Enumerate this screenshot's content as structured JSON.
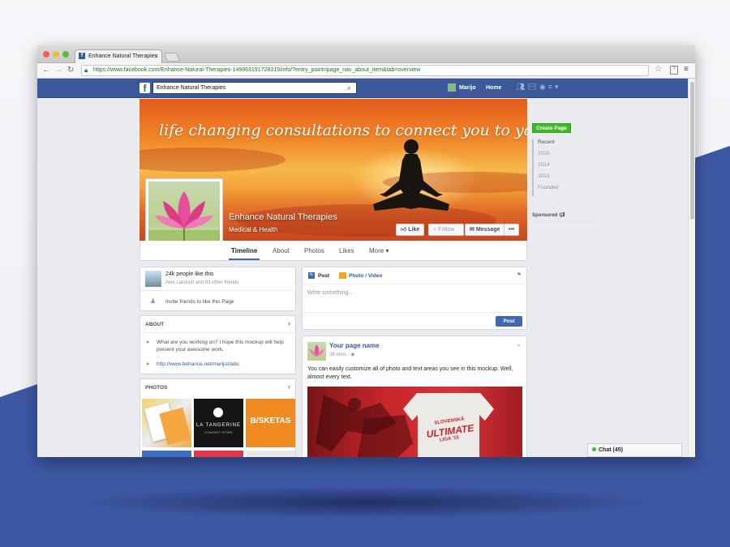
{
  "browser": {
    "tab_title": "Enhance Natural Therapies",
    "url": "https://www.facebook.com/Enhance-Natural-Therapies-149863191728319/info/?entry_point=page_nav_about_item&tab=overview"
  },
  "fbbar": {
    "search_value": "Enhance Natural Therapies",
    "user_name": "Marijo",
    "home_label": "Home"
  },
  "cover": {
    "tagline": "life changing consultations to connect you to your true self",
    "page_name": "Enhance Natural Therapies",
    "category": "Medical & Health",
    "like_label": "Like",
    "follow_label": "Follow",
    "message_label": "Message",
    "more_label": "•••"
  },
  "tabs": [
    {
      "label": "Timeline"
    },
    {
      "label": "About"
    },
    {
      "label": "Photos"
    },
    {
      "label": "Likes"
    },
    {
      "label": "More ▾"
    }
  ],
  "likes_card": {
    "count_text": "24k people like this",
    "friends_text": "Alex Lalovich and 83 other friends",
    "invite_text": "Invite friends to like this Page"
  },
  "about_card": {
    "title": "ABOUT",
    "description": "What are you working on? I hope this mockup will help present your awesome work.",
    "website": "http://www.behance.net/marijoziatic"
  },
  "photos_card": {
    "title": "PHOTOS",
    "tangerine_text": "LA TANGERINE",
    "tangerine_sub": "CONCEPT STORE",
    "basketas_text": "B/SKETAS"
  },
  "composer": {
    "post_tab": "Post",
    "photo_tab": "Photo / Video",
    "placeholder": "Write something...",
    "post_button": "Post"
  },
  "post": {
    "author": "Your page name",
    "time": "38 mins",
    "text": "You can easily customize all of photo and text areas you see in this mockup. Well, almost every text.",
    "shirt_line1": "SLOVENSKÁ",
    "shirt_line2": "ULTIMATE",
    "shirt_line3": "LIGA '15"
  },
  "sidebar": {
    "create_page": "Create Page",
    "years": [
      "Recent",
      "2015",
      "2014",
      "2013",
      "Founded"
    ],
    "sponsored": "Sponsored"
  },
  "chat": {
    "label": "Chat (45)"
  },
  "colors": {
    "fb_blue": "#3b5998",
    "create_green": "#42b72a",
    "page_bg_blue": "#3d57a3"
  }
}
